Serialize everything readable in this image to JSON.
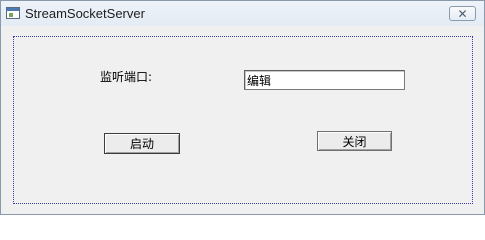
{
  "window": {
    "title": "StreamSocketServer",
    "close_icon": "✕"
  },
  "form": {
    "port_label": "监听端口:",
    "port_input_value": "编辑"
  },
  "buttons": {
    "start_label": "启动",
    "close_label": "关闭"
  }
}
